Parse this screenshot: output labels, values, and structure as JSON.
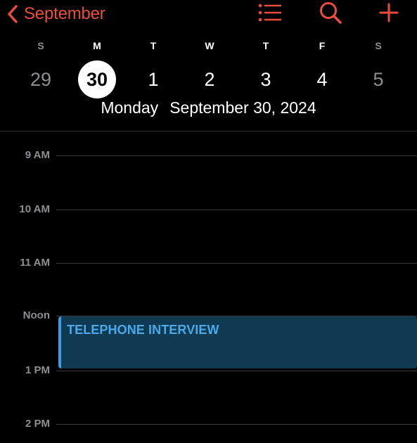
{
  "header": {
    "back_label": "September",
    "icons": [
      "chevron-left-icon",
      "list-icon",
      "search-icon",
      "plus-icon"
    ],
    "accent_color": "#eb4d3d"
  },
  "week": {
    "days": [
      {
        "dow": "S",
        "num": "29",
        "weekend": true
      },
      {
        "dow": "M",
        "num": "30",
        "selected": true
      },
      {
        "dow": "T",
        "num": "1"
      },
      {
        "dow": "W",
        "num": "2"
      },
      {
        "dow": "T",
        "num": "3"
      },
      {
        "dow": "F",
        "num": "4"
      },
      {
        "dow": "S",
        "num": "5",
        "weekend": true
      }
    ]
  },
  "selected_date": {
    "weekday": "Monday",
    "date": "September 30, 2024"
  },
  "timeline": {
    "hours": [
      "9 AM",
      "10 AM",
      "11 AM",
      "Noon",
      "1 PM",
      "2 PM"
    ]
  },
  "event": {
    "title": "TELEPHONE INTERVIEW",
    "color": "#4ba9e8"
  }
}
